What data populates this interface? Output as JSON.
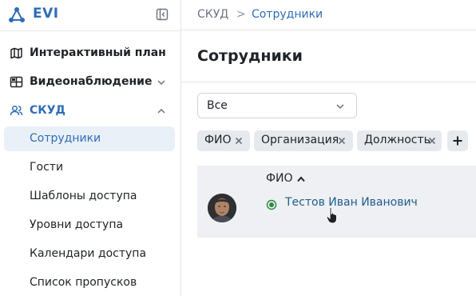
{
  "brand": {
    "name": "EVI"
  },
  "sidebar": {
    "items": [
      {
        "label": "Интерактивный план",
        "icon": "map-icon",
        "has_chevron": false
      },
      {
        "label": "Видеонаблюдение",
        "icon": "video-grid-icon",
        "has_chevron": true,
        "chevron": "down"
      },
      {
        "label": "СКУД",
        "icon": "users-icon",
        "has_chevron": true,
        "chevron": "up",
        "expanded": true
      }
    ],
    "subitems": [
      {
        "label": "Сотрудники",
        "selected": true
      },
      {
        "label": "Гости",
        "selected": false
      },
      {
        "label": "Шаблоны доступа",
        "selected": false
      },
      {
        "label": "Уровни доступа",
        "selected": false
      },
      {
        "label": "Календари доступа",
        "selected": false
      },
      {
        "label": "Список пропусков",
        "selected": false
      }
    ]
  },
  "breadcrumb": {
    "root": "СКУД",
    "separator": ">",
    "current": "Сотрудники"
  },
  "page": {
    "title": "Сотрудники"
  },
  "filter": {
    "selected": "Все"
  },
  "columns_chips": [
    "ФИО",
    "Организация",
    "Должность"
  ],
  "table": {
    "header": "ФИО",
    "sort": "ascending",
    "rows": [
      {
        "name": "Тестов Иван Иванович",
        "status": "active"
      }
    ]
  },
  "colors": {
    "accent": "#2f6db5",
    "link": "#1f5d8c",
    "status_active": "#2e8b3e",
    "selected_bg": "#eaf0f8",
    "chip_bg": "#e6e9ed"
  }
}
